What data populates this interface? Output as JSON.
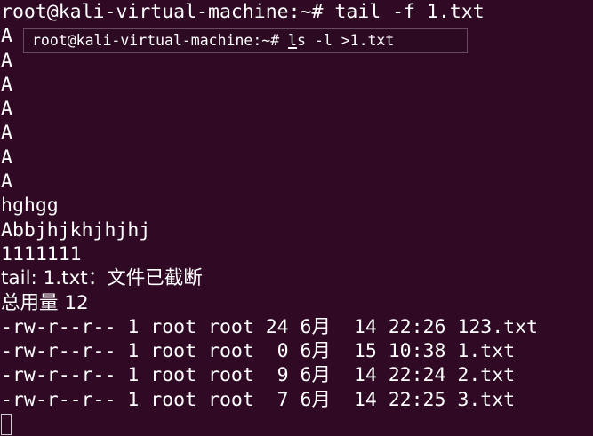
{
  "terminal": {
    "prompt_line": "root@kali-virtual-machine:~# tail -f 1.txt",
    "output_lines": [
      "A",
      "A",
      "A",
      "A",
      "A",
      "A",
      "A",
      "hghgg",
      "Abbjhjkhjhjhj",
      "1111111",
      "tail: 1.txt：文件已截断",
      "总用量 12",
      "-rw-r--r-- 1 root root 24 6月  14 22:26 123.txt",
      "-rw-r--r-- 1 root root  0 6月  15 10:38 1.txt",
      "-rw-r--r-- 1 root root  9 6月  14 22:24 2.txt",
      "-rw-r--r-- 1 root root  7 6月  14 22:25 3.txt"
    ],
    "overlay_command": {
      "prefix": "root@kali-virtual-machine:~# ",
      "cursor_char": "l",
      "suffix": "s -l >1.txt"
    }
  },
  "colors": {
    "background": "#300a24",
    "foreground": "#ffffff"
  }
}
